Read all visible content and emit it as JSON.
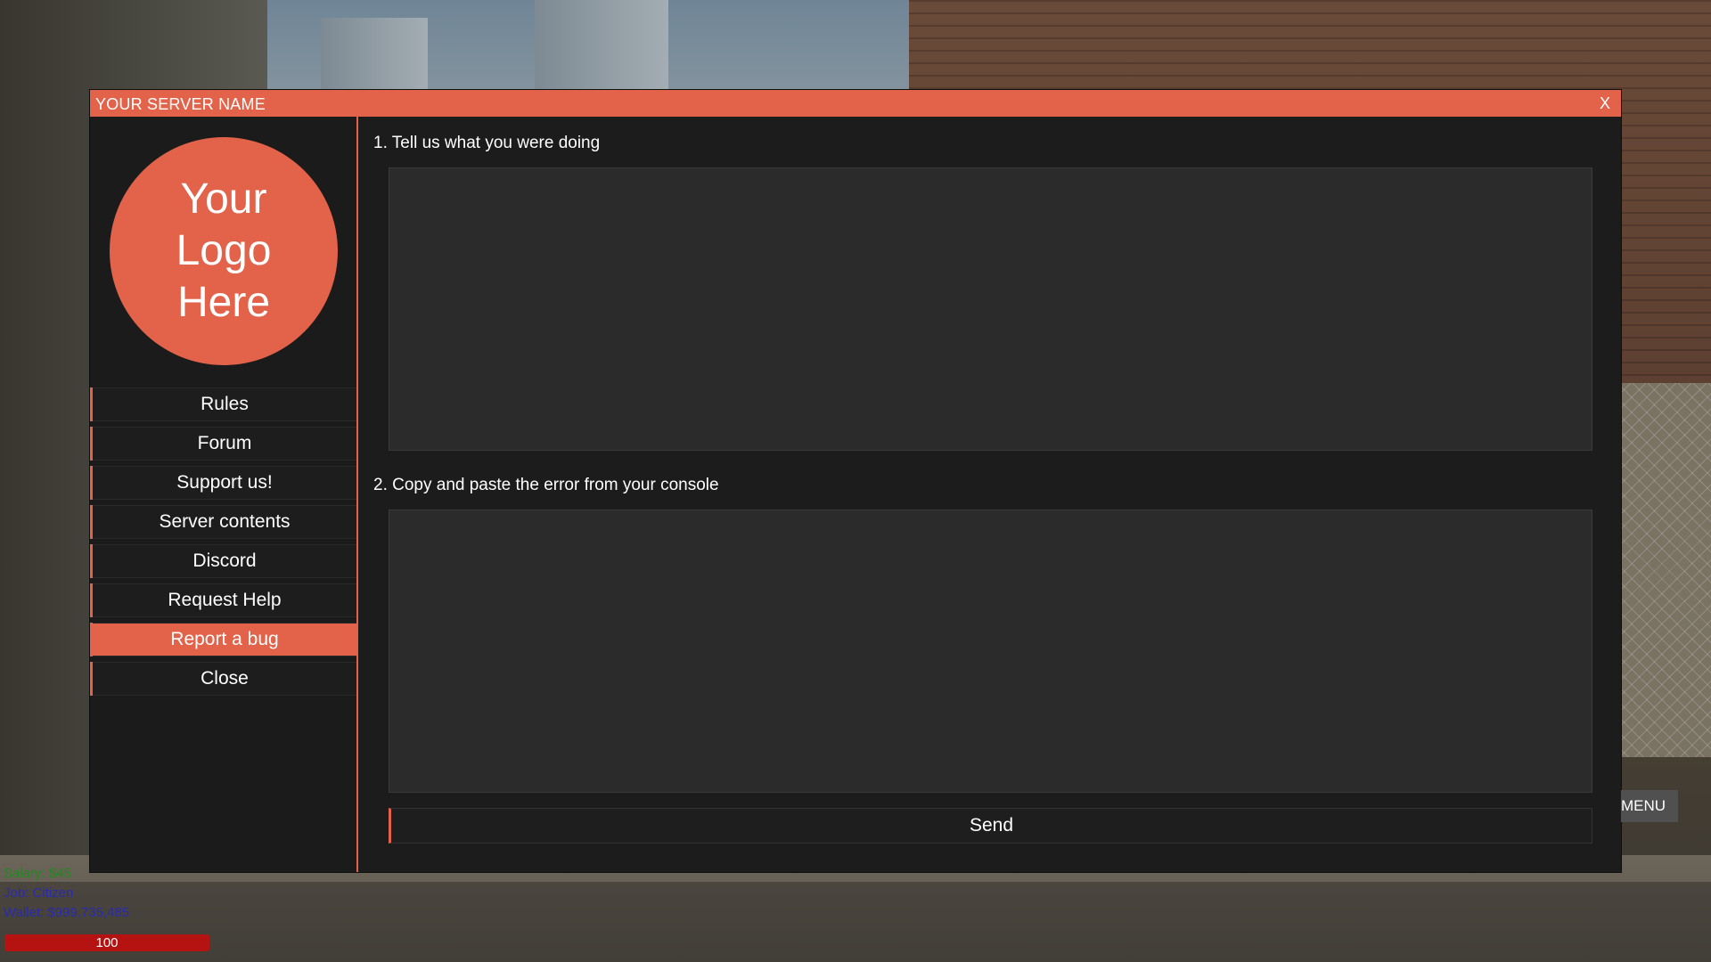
{
  "window": {
    "title": "YOUR SERVER NAME",
    "close_label": "X",
    "accent_color": "#e2624a"
  },
  "sidebar": {
    "logo_text": "Your Logo Here",
    "items": [
      {
        "label": "Rules",
        "active": false
      },
      {
        "label": "Forum",
        "active": false
      },
      {
        "label": "Support us!",
        "active": false
      },
      {
        "label": "Server contents",
        "active": false
      },
      {
        "label": "Discord",
        "active": false
      },
      {
        "label": "Request Help",
        "active": false
      },
      {
        "label": "Report a bug",
        "active": true
      },
      {
        "label": "Close",
        "active": false
      }
    ]
  },
  "bug_report": {
    "step1_label": "1. Tell us what you were doing",
    "step1_value": "",
    "step2_label": "2. Copy and paste the error from your console",
    "step2_value": "",
    "send_label": "Send"
  },
  "hud": {
    "menu_label": "MENU",
    "salary": "Salary: $45",
    "job": "Job: Citizen",
    "wallet": "Wallet: $999,735,485",
    "health": "100"
  }
}
